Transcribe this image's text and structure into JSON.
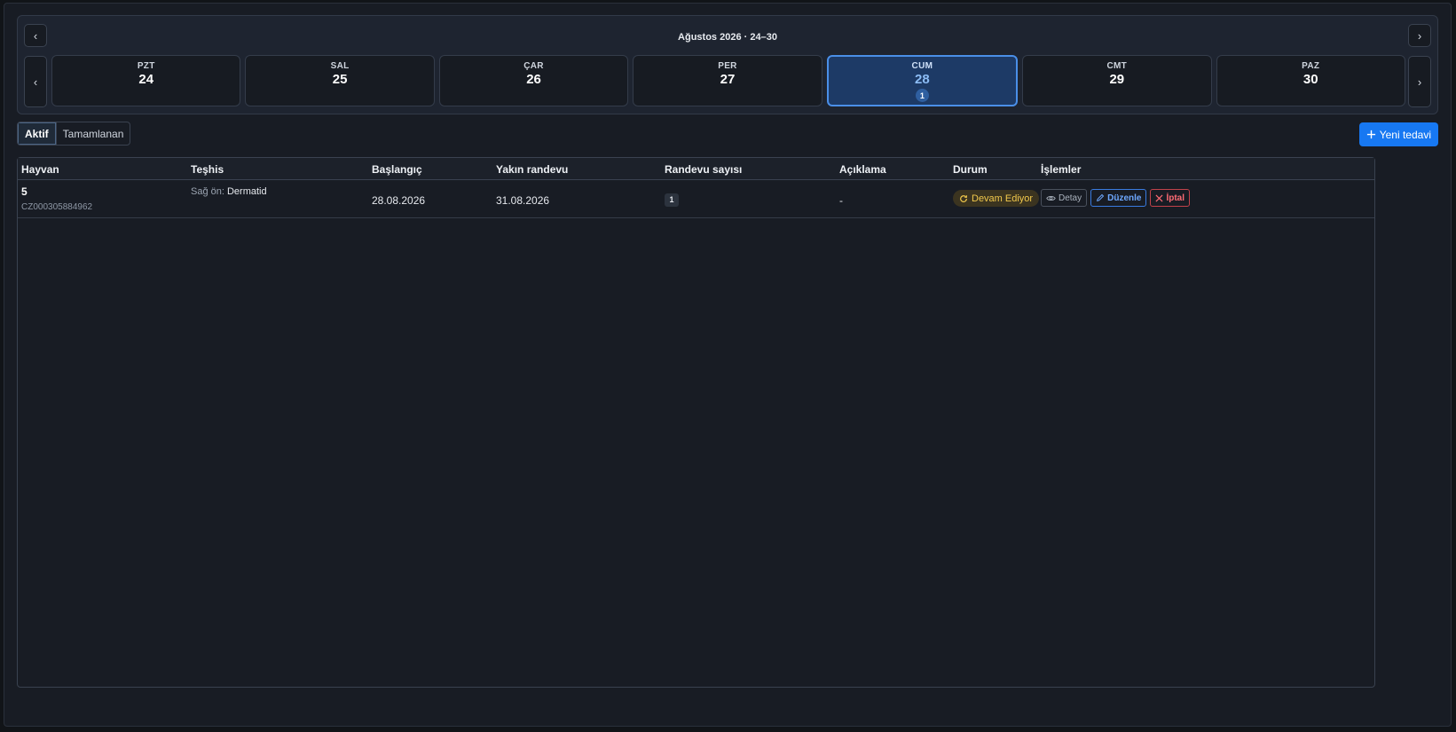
{
  "week": {
    "title": "Ağustos 2026 · 24–30",
    "prev_label": "‹",
    "next_label": "›",
    "days": [
      {
        "name": "PZT",
        "date": "24",
        "count": ""
      },
      {
        "name": "SAL",
        "date": "25",
        "count": ""
      },
      {
        "name": "ÇAR",
        "date": "26",
        "count": ""
      },
      {
        "name": "PER",
        "date": "27",
        "count": ""
      },
      {
        "name": "CUM",
        "date": "28",
        "count": "1",
        "active": true
      },
      {
        "name": "CMT",
        "date": "29",
        "count": ""
      },
      {
        "name": "PAZ",
        "date": "30",
        "count": ""
      }
    ]
  },
  "filters": {
    "active_label": "Aktif",
    "completed_label": "Tamamlanan"
  },
  "new_treatment_label": "Yeni tedavi",
  "table": {
    "headers": {
      "animal": "Hayvan",
      "diagnosis": "Teşhis",
      "start": "Başlangıç",
      "next_appointment": "Yakın randevu",
      "appointment_count": "Randevu sayısı",
      "description": "Açıklama",
      "status": "Durum",
      "actions": "İşlemler"
    },
    "rows": [
      {
        "animal_name": "5",
        "animal_chip": "CZ000305884962",
        "diagnosis_location": "Sağ ön:",
        "diagnosis": "Dermatid",
        "start": "28.08.2026",
        "next_appointment": "31.08.2026",
        "appointment_count": "1",
        "description": "-",
        "status": "Devam Ediyor",
        "detail_label": "Detay",
        "edit_label": "Düzenle",
        "cancel_label": "İptal"
      }
    ]
  },
  "colors": {
    "accent": "#1778f2",
    "status_ongoing": "#f2c94c",
    "danger": "#ff6b74"
  }
}
